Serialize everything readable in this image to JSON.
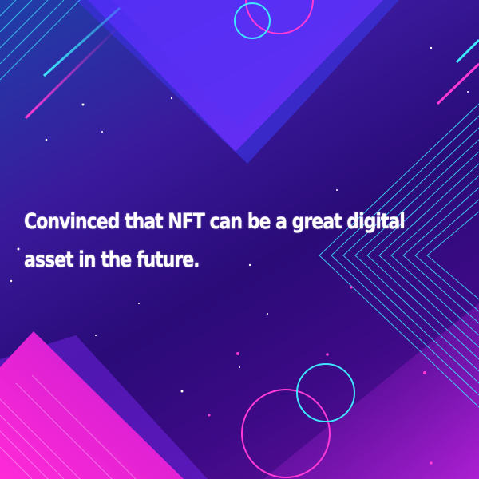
{
  "caption": {
    "text": "Convinced that NFT can be a great digital asset in the future."
  },
  "colors": {
    "background_top": "#1f3fa8",
    "background_mid": "#2a0b78",
    "accent_purple": "#5b3cf2",
    "accent_magenta": "#ff1fd2",
    "accent_cyan": "#3ee6ff",
    "text": "#ffffff"
  }
}
